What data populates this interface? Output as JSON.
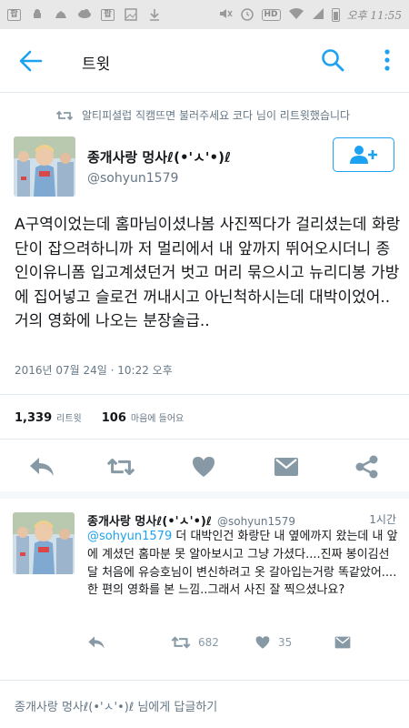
{
  "status_bar": {
    "time": "오후 11:55",
    "hd": "HD",
    "notif_glyph_1": "팝",
    "notif_glyph_2": "팝",
    "icons": [
      "android-icon",
      "weather-icon",
      "cloud-icon",
      "app-icon",
      "image-icon",
      "download-icon",
      "mute-icon",
      "alarm-icon",
      "wifi-icon",
      "signal-icon",
      "battery-icon"
    ]
  },
  "app_bar": {
    "title": "트윗",
    "icons": [
      "back-arrow-icon",
      "search-icon",
      "more-icon"
    ]
  },
  "retweet_context": {
    "text": "알티피셜럽 직캠뜨면 불러주세요 코다 님이 리트윗했습니다"
  },
  "tweet": {
    "author_name": "종개사랑 멍사ℓ(•'ㅅ'•)ℓ",
    "author_handle": "@sohyun1579",
    "text": "A구역이었는데 홈마님이셨나봄 사진찍다가 걸리셨는데 화랑단이 잡으려하니까 저 멀리에서 내 앞까지 뛰어오시더니 종인이유니폼 입고계셨던거 벗고 머리 묶으시고 뉴리디봉 가방에 집어넣고 슬로건 꺼내시고 아닌척하시는데 대박이었어..거의 영화에 나오는 분장술급..",
    "timestamp": "2016년 07월 24일 · 10:22 오후",
    "retweet_count": "1,339",
    "retweet_label": "리트윗",
    "like_count": "106",
    "like_label": "마음에 들어요"
  },
  "reply": {
    "author_name": "종개사랑 멍사ℓ(•'ㅅ'•)ℓ",
    "author_handle": "@sohyun1579",
    "time_ago": "1시간",
    "mention": "@sohyun1579",
    "text": " 더 대박인건 화랑단 내 옆에까지 왔는데 내 앞에 계셨던 홈마분 못 알아보시고 그냥 가셨다....진짜 봉이김선달 처음에 유승호님이 변신하려고 옷 갈아입는거랑 똑같았어....한 편의 영화를 본 느낌..그래서 사진 잘 찍으셨나요?",
    "retweet_count": "682",
    "like_count": "35"
  },
  "reply_bar": {
    "prompt": "종개사랑 멍사ℓ(•'ㅅ'•)ℓ 님에게 답글하기"
  },
  "colors": {
    "accent": "#1da1f2",
    "text": "#14171a",
    "secondary": "#657786",
    "icon": "#8899a6"
  }
}
